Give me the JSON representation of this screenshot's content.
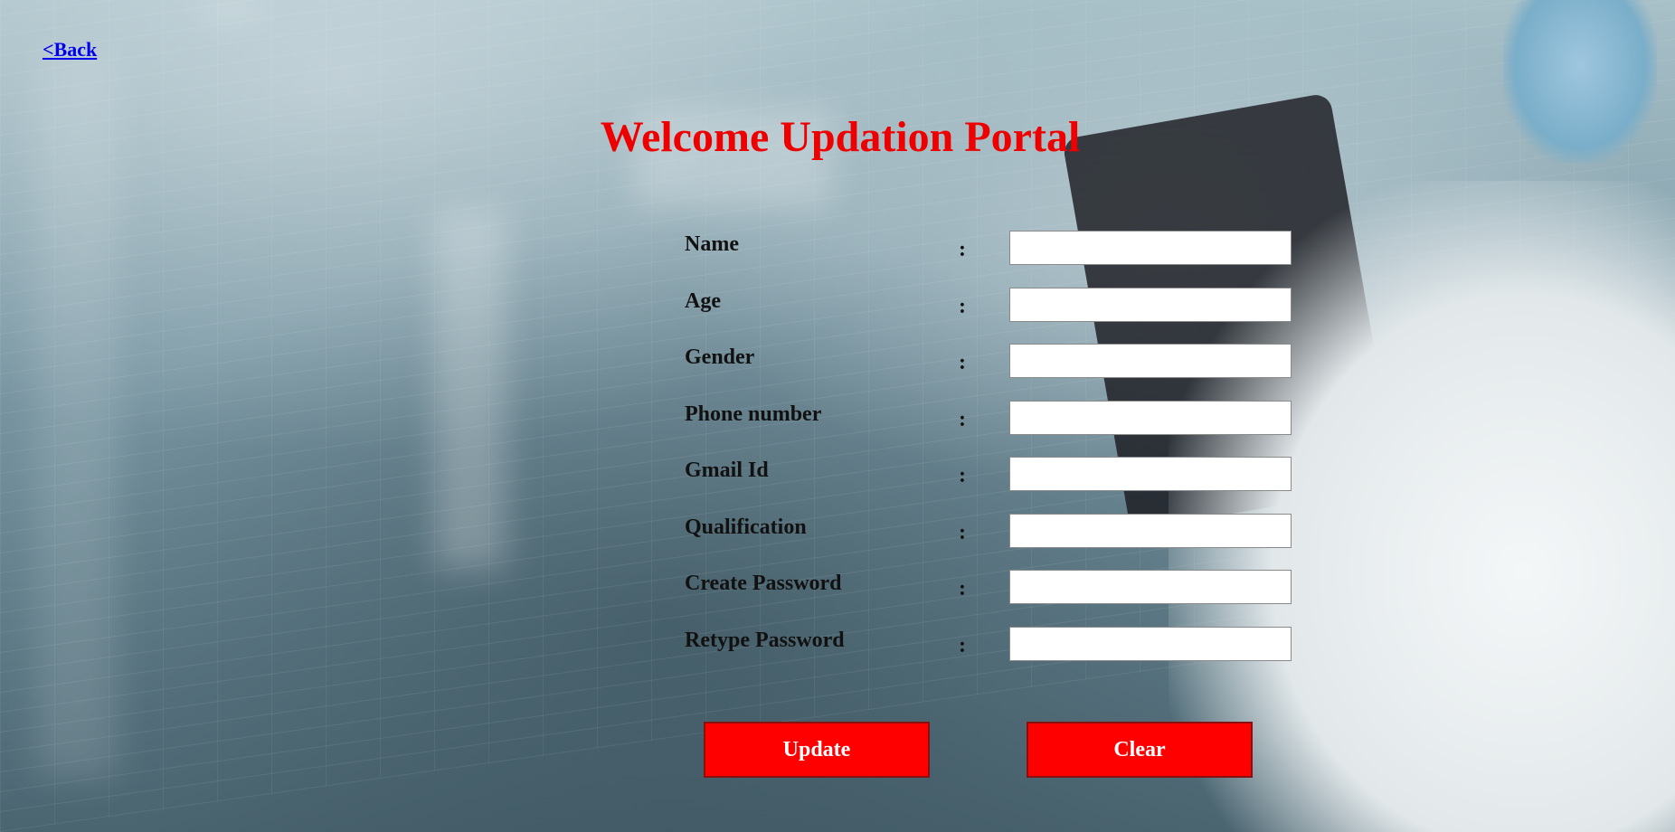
{
  "nav": {
    "back_label": "<Back"
  },
  "header": {
    "title": "Welcome Updation Portal"
  },
  "form": {
    "colon": ":",
    "fields": [
      {
        "label": "Name",
        "value": ""
      },
      {
        "label": "Age",
        "value": ""
      },
      {
        "label": "Gender",
        "value": ""
      },
      {
        "label": "Phone number",
        "value": ""
      },
      {
        "label": "Gmail Id",
        "value": ""
      },
      {
        "label": "Qualification",
        "value": ""
      },
      {
        "label": "Create Password",
        "value": ""
      },
      {
        "label": "Retype Password",
        "value": ""
      }
    ]
  },
  "actions": {
    "update_label": "Update",
    "clear_label": "Clear"
  },
  "colors": {
    "title": "#ee0000",
    "button_bg": "#ff0000",
    "button_text": "#ffffff",
    "link": "#0000ee"
  }
}
